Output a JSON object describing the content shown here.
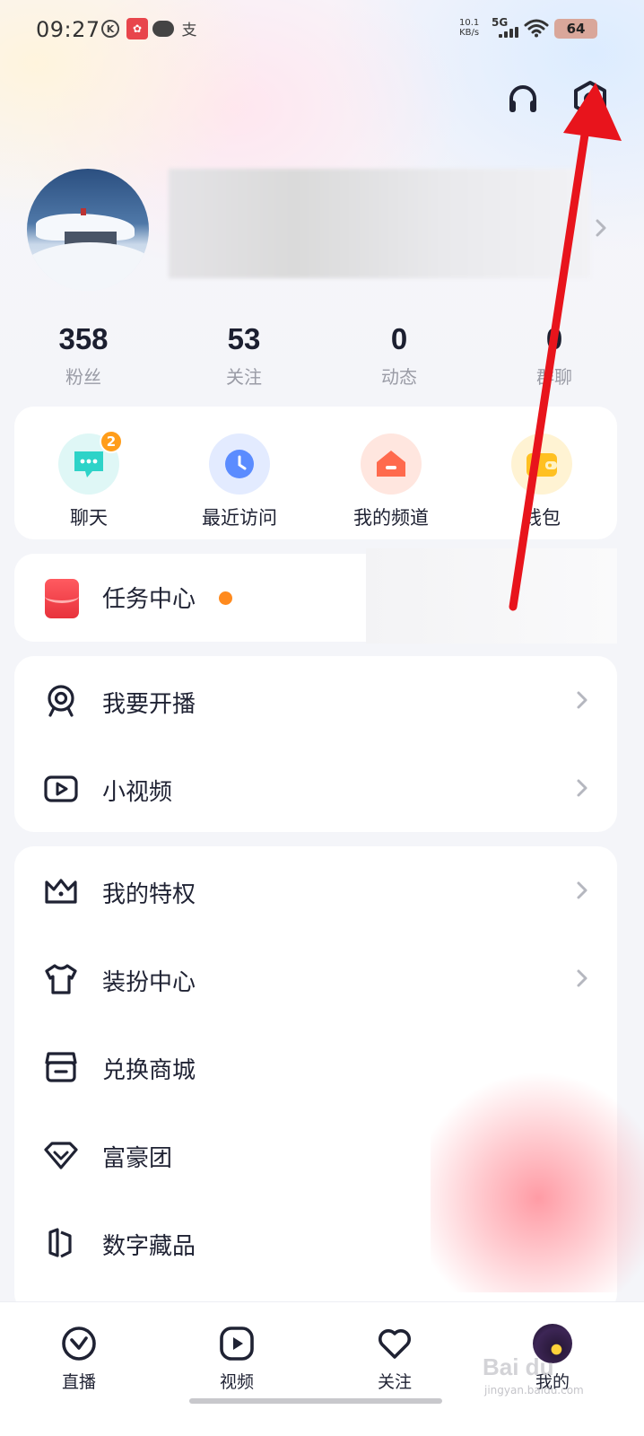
{
  "status_bar": {
    "time": "09:27",
    "speed_value": "10.1",
    "speed_unit": "KB/s",
    "network": "5G",
    "battery": "64",
    "icons": [
      "k-icon",
      "app-red-icon",
      "chat-bubble-icon",
      "alipay-icon",
      "signal-icon",
      "wifi-icon",
      "battery-icon"
    ]
  },
  "header": {
    "icons": [
      "headphones-icon",
      "settings-hexagon-icon"
    ]
  },
  "profile": {
    "avatar": "snow-house-avatar"
  },
  "stats": [
    {
      "value": "358",
      "label": "粉丝"
    },
    {
      "value": "53",
      "label": "关注"
    },
    {
      "value": "0",
      "label": "动态"
    },
    {
      "value": "0",
      "label": "群聊"
    }
  ],
  "quick_actions": [
    {
      "label": "聊天",
      "badge": "2",
      "icon": "chat-icon",
      "color": "#2ed3c8"
    },
    {
      "label": "最近访问",
      "icon": "clock-icon",
      "color": "#5b8cff"
    },
    {
      "label": "我的频道",
      "icon": "channel-house-icon",
      "color": "#ff6a4d"
    },
    {
      "label": "钱包",
      "icon": "wallet-icon",
      "color": "#ffc021"
    }
  ],
  "task_center": {
    "label": "任务中心",
    "dot_color": "#ff8a1e"
  },
  "menu_group1": [
    {
      "label": "我要开播",
      "icon": "live-camera-icon"
    },
    {
      "label": "小视频",
      "icon": "video-play-icon"
    }
  ],
  "menu_group2": [
    {
      "label": "我的特权",
      "icon": "crown-icon"
    },
    {
      "label": "装扮中心",
      "icon": "tshirt-icon"
    },
    {
      "label": "兑换商城",
      "icon": "store-icon"
    },
    {
      "label": "富豪团",
      "icon": "diamond-icon"
    },
    {
      "label": "数字藏品",
      "icon": "collectible-icon"
    }
  ],
  "tab_bar": [
    {
      "label": "直播",
      "icon": "live-tab-icon"
    },
    {
      "label": "视频",
      "icon": "video-tab-icon"
    },
    {
      "label": "关注",
      "icon": "heart-tab-icon"
    },
    {
      "label": "我的",
      "icon": "profile-avatar-tab"
    }
  ],
  "watermark": {
    "text": "Bai du",
    "sub": "jingyan.baidu.com"
  },
  "colors": {
    "background": "#f4f5f9",
    "card": "#ffffff",
    "text_primary": "#1f2233",
    "text_secondary": "#9a9ca6",
    "annotation_arrow": "#e8141c"
  }
}
